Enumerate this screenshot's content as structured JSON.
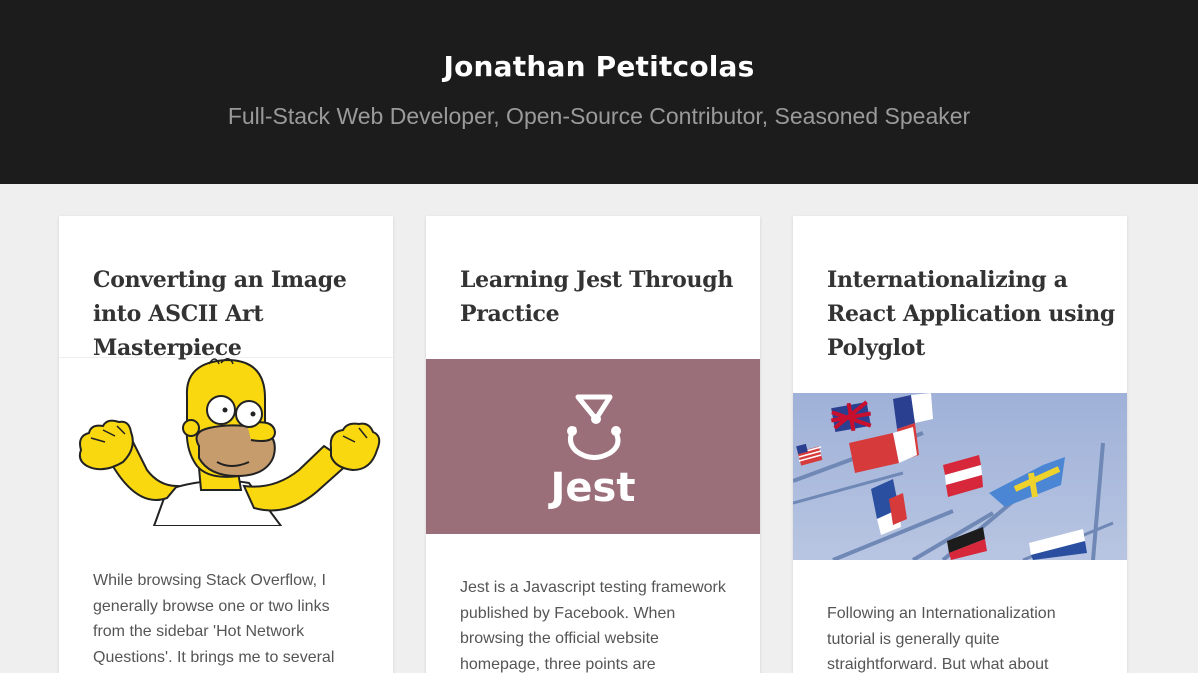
{
  "header": {
    "title": "Jonathan Petitcolas",
    "tagline": "Full-Stack Web Developer, Open-Source Contributor, Seasoned Speaker"
  },
  "posts": [
    {
      "title": "Converting an Image into ASCII Art Masterpiece",
      "image_icon": "homer-simpson-cheering-illustration",
      "excerpt": "While browsing Stack Overflow, I generally browse one or two links from the sidebar 'Hot Network Questions'. It brings me to several"
    },
    {
      "title": "Learning Jest Through Practice",
      "image_icon": "jest-logo",
      "image_text": "Jest",
      "image_bg": "#9b6f7a",
      "excerpt": "Jest is a Javascript testing framework published by Facebook. When browsing the official website homepage, three points are"
    },
    {
      "title": "Internationalizing a React Application using Polyglot",
      "image_icon": "international-flags-photo",
      "excerpt": "Following an Internationalization tutorial is generally quite straightforward. But what about"
    }
  ],
  "colors": {
    "header_bg": "#1c1c1c",
    "page_bg": "#efefef",
    "jest_bg": "#9b6f7a",
    "sky": "#a9b9dd"
  }
}
